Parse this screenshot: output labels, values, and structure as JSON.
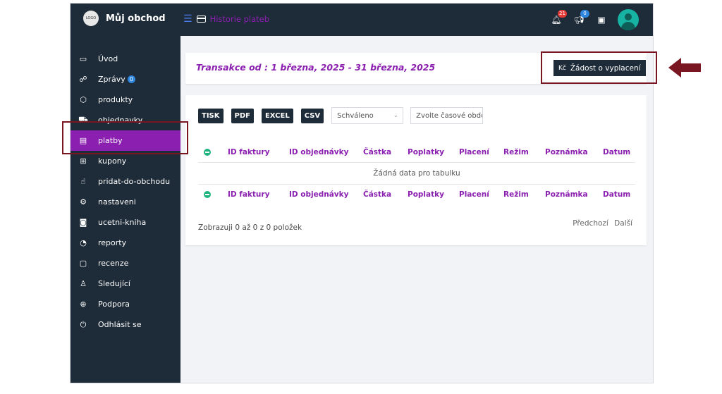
{
  "brand": {
    "logo_text": "LOGO",
    "name": "Můj obchod"
  },
  "breadcrumb": {
    "title": "Historie plateb"
  },
  "topbar": {
    "notifications_count": "21",
    "announcements_count": "0"
  },
  "sidebar": {
    "items": [
      {
        "label": "Úvod",
        "icon": "monitor-icon",
        "glyph": "▭"
      },
      {
        "label": "Zprávy",
        "icon": "chat-icon",
        "glyph": "☍",
        "badge": "0"
      },
      {
        "label": "produkty",
        "icon": "box-icon",
        "glyph": "⬡"
      },
      {
        "label": "objednavky",
        "icon": "cart-icon",
        "glyph": "⛟"
      },
      {
        "label": "platby",
        "icon": "card-icon",
        "glyph": "▤",
        "active": true
      },
      {
        "label": "kupony",
        "icon": "gift-icon",
        "glyph": "⊞"
      },
      {
        "label": "pridat-do-obchodu",
        "icon": "hand-icon",
        "glyph": "☝"
      },
      {
        "label": "nastaveni",
        "icon": "gears-icon",
        "glyph": "⚙"
      },
      {
        "label": "ucetni-kniha",
        "icon": "money-icon",
        "glyph": "◙"
      },
      {
        "label": "reporty",
        "icon": "chart-icon",
        "glyph": "◔"
      },
      {
        "label": "recenze",
        "icon": "comment-icon",
        "glyph": "▢"
      },
      {
        "label": "Sledující",
        "icon": "shirt-icon",
        "glyph": "♙"
      },
      {
        "label": "Podpora",
        "icon": "globe-icon",
        "glyph": "⊕"
      },
      {
        "label": "Odhlásit se",
        "icon": "power-icon",
        "glyph": "⏻"
      }
    ]
  },
  "transactions": {
    "title": "Transakce od : 1 března, 2025 - 31 března, 2025"
  },
  "payout": {
    "icon_text": "Kč",
    "label": "Žádost o vyplacení"
  },
  "toolbar": {
    "print": "TISK",
    "pdf": "PDF",
    "excel": "EXCEL",
    "csv": "CSV",
    "status_value": "Schváleno",
    "date_placeholder": "Zvolte časové období"
  },
  "table": {
    "columns": [
      "ID faktury",
      "ID objednávky",
      "Částka",
      "Poplatky",
      "Placení",
      "Režim",
      "Poznámka",
      "Datum"
    ],
    "empty_message": "Žádná data pro tabulku"
  },
  "footer": {
    "info": "Zobrazuji 0 až 0 z 0 položek",
    "prev": "Předchozí",
    "next": "Další"
  },
  "colors": {
    "sidebar": "#1e2b38",
    "accent": "#8b1fb0",
    "highlight": "#7a1621",
    "success": "#1fb37e"
  }
}
